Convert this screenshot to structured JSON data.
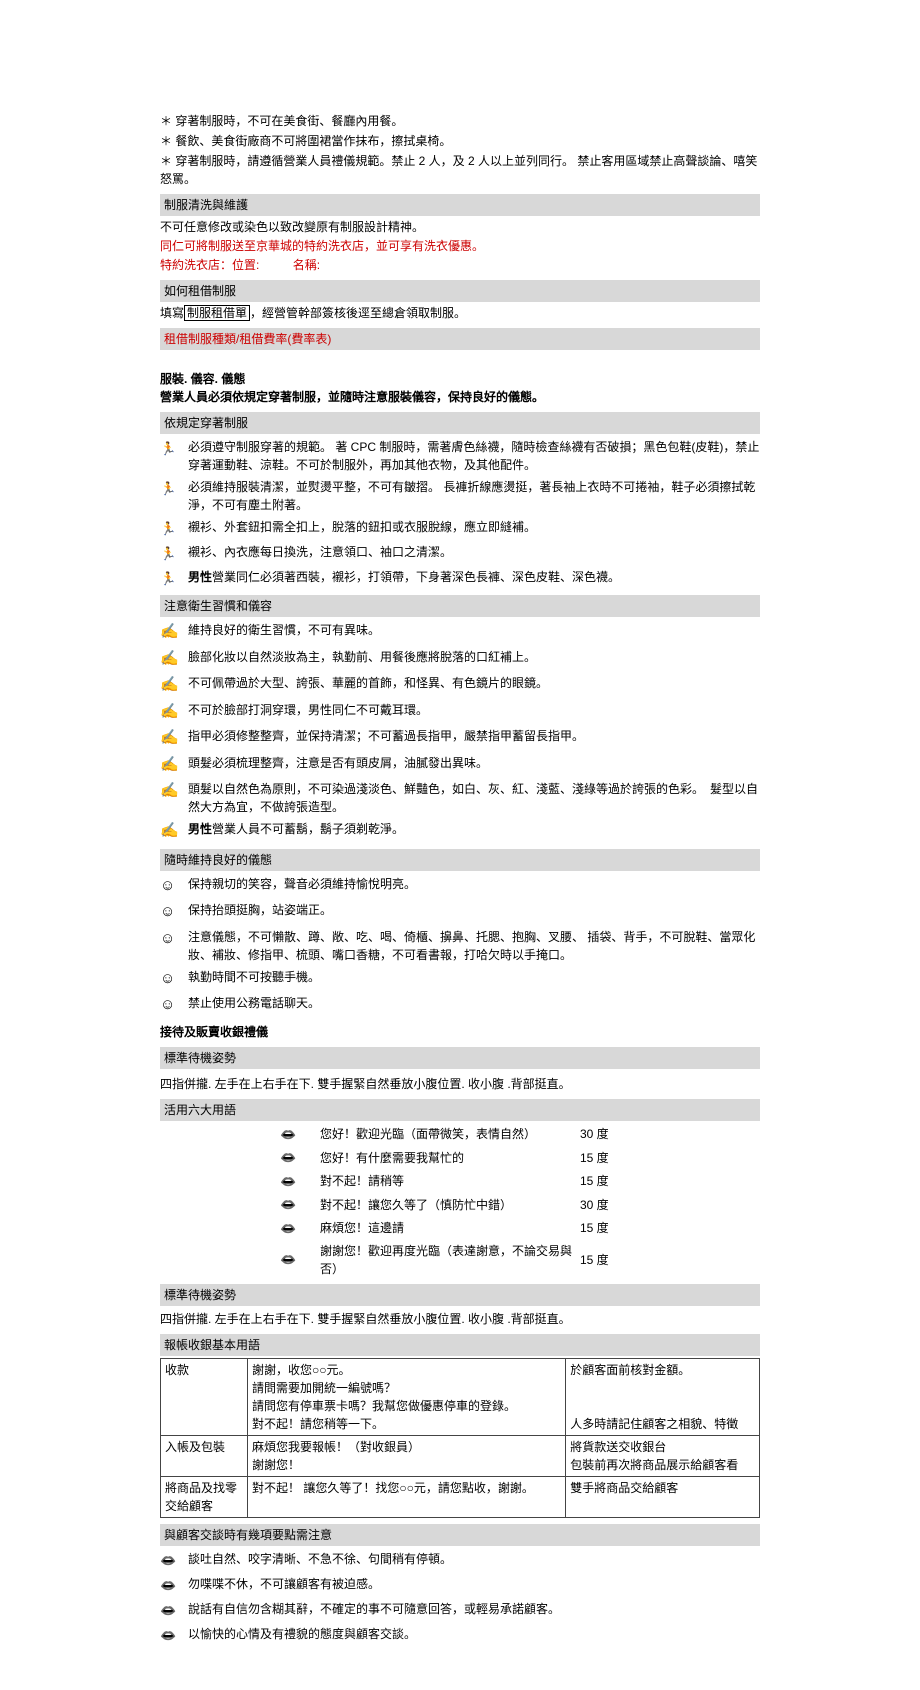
{
  "top_rules": [
    "＊ 穿著制服時，不可在美食街、餐廳內用餐。",
    "＊ 餐飲、美食街廠商不可將圍裙當作抹布，擦拭桌椅。",
    "＊ 穿著制服時，請遵循營業人員禮儀規範。禁止 2 人，及 2 人以上並列同行。 禁止客用區域禁止高聲談論、嘻笑怒罵。"
  ],
  "headers": {
    "wash": "制服清洗與維護",
    "rent": "如何租借制服",
    "rent_fee": "租借制服種類/租借費率(費率表)",
    "dress_title": "服裝. 儀容. 儀態",
    "dress_sub": "營業人員必須依規定穿著制服，並隨時注意服裝儀容，保持良好的儀態。",
    "uniform": "依規定穿著制服",
    "hygiene": "注意衛生習慣和儀容",
    "manner": "隨時維持良好的儀態",
    "service_title": "接待及販賣收銀禮儀",
    "standby": "標準待機姿勢",
    "six": "活用六大用語",
    "cashier": "報帳收銀基本用語",
    "talk": "與顧客交談時有幾項要點需注意"
  },
  "wash": {
    "l1": "不可任意修改或染色以致改變原有制服設計精神。",
    "l2": "同仁可將制服送至京華城的特約洗衣店，並可享有洗衣優惠。",
    "l3a": "特約洗衣店：位置:",
    "l3b": "名稱:"
  },
  "rent": {
    "pre": "填寫",
    "boxed": "制服租借單",
    "post": "，經營管幹部簽核後逕至總倉領取制服。"
  },
  "uniform_items": [
    "必須遵守制服穿著的規範。 著 CPC 制服時，需著膚色絲襪，隨時檢查絲襪有否破損；黑色包鞋(皮鞋)，禁止穿著運動鞋、涼鞋。不可於制服外，再加其他衣物，及其他配件。",
    "必須維持服裝清潔，並熨燙平整，不可有皺摺。 長褲折線應燙挺，著長袖上衣時不可捲袖，鞋子必須擦拭乾淨，不可有塵土附著。",
    "襯衫、外套鈕扣需全扣上，脫落的鈕扣或衣服脫線，應立即縫補。",
    "襯衫、內衣應每日換洗，注意領口、袖口之清潔。",
    "男性營業同仁必須著西裝，襯衫，打領帶，下身著深色長褲、深色皮鞋、深色襪。"
  ],
  "uniform_bold_indices": [
    4
  ],
  "hygiene_items": [
    "維持良好的衛生習慣，不可有異味。",
    "臉部化妝以自然淡妝為主，執勤前、用餐後應將脫落的口紅補上。",
    "不可佩帶過於大型、誇張、華麗的首飾，和怪異、有色鏡片的眼鏡。",
    "不可於臉部打洞穿環，男性同仁不可戴耳環。",
    "指甲必須修整整齊，並保持清潔；不可蓄過長指甲，嚴禁指甲蓄留長指甲。",
    "頭髮必須梳理整齊，注意是否有頭皮屑，油膩發出異味。",
    "頭髮以自然色為原則，不可染過淺淡色、鮮豔色，如白、灰、紅、淺藍、淺綠等過於誇張的色彩。　髮型以自然大方為宜，不做誇張造型。",
    "男性營業人員不可蓄鬍，鬍子須剃乾淨。"
  ],
  "hygiene_bold_indices": [
    7
  ],
  "manner_items": [
    "保持親切的笑容，聲音必須維持愉悅明亮。",
    "保持抬頭挺胸，站姿端正。",
    "注意儀態，不可懶散、蹲、敞、吃、喝、倚櫃、擤鼻、托腮、抱胸、叉腰、 插袋、背手，不可脫鞋、當眾化妝、補妝、修指甲、梳頭、嘴口香糖，不可看書報，打哈欠時以手掩口。",
    "執勤時間不可按聽手機。",
    "禁止使用公務電話聊天。"
  ],
  "standby_text": "四指併攏. 左手在上右手在下. 雙手握緊自然垂放小腹位置.  收小腹 .背部挺直。",
  "phrases": [
    {
      "t": "您好！歡迎光臨（面帶微笑，表情自然）",
      "d": "30 度"
    },
    {
      "t": "您好！有什麼需要我幫忙的",
      "d": "15 度"
    },
    {
      "t": "對不起！請稍等",
      "d": "15 度"
    },
    {
      "t": "對不起！讓您久等了（慎防忙中錯）",
      "d": "30 度"
    },
    {
      "t": "麻煩您！這邊請",
      "d": "15 度"
    },
    {
      "t": "謝謝您！歡迎再度光臨（表達謝意，不論交易與否）",
      "d": "15 度"
    }
  ],
  "standby2": "四指併攏. 左手在上右手在下. 雙手握緊自然垂放小腹位置.  收小腹 .背部挺直。",
  "cashier_table": [
    [
      "收款",
      "謝謝，收您○○元。\n請問需要加開統一編號嗎？\n請問您有停車票卡嗎？我幫您做優惠停車的登錄。\n對不起！請您稍等一下。",
      "於顧客面前核對金額。\n\n\n人多時請記住顧客之相貌、特徵"
    ],
    [
      "入帳及包裝",
      "麻煩您我要報帳！（對收銀員）\n謝謝您！",
      "將貨款送交收銀台\n包裝前再次將商品展示給顧客看"
    ],
    [
      "將商品及找零交給顧客",
      "對不起！ 讓您久等了！找您○○元，請您點收，謝謝。",
      "雙手將商品交給顧客"
    ]
  ],
  "talk_items": [
    "談吐自然、咬字清晰、不急不徐、句間稍有停頓。",
    "勿喋喋不休，不可讓顧客有被迫感。",
    "說話有自信勿含糊其辭，不確定的事不可隨意回答，或輕易承諾顧客。",
    "以愉快的心情及有禮貌的態度與顧客交談。"
  ]
}
